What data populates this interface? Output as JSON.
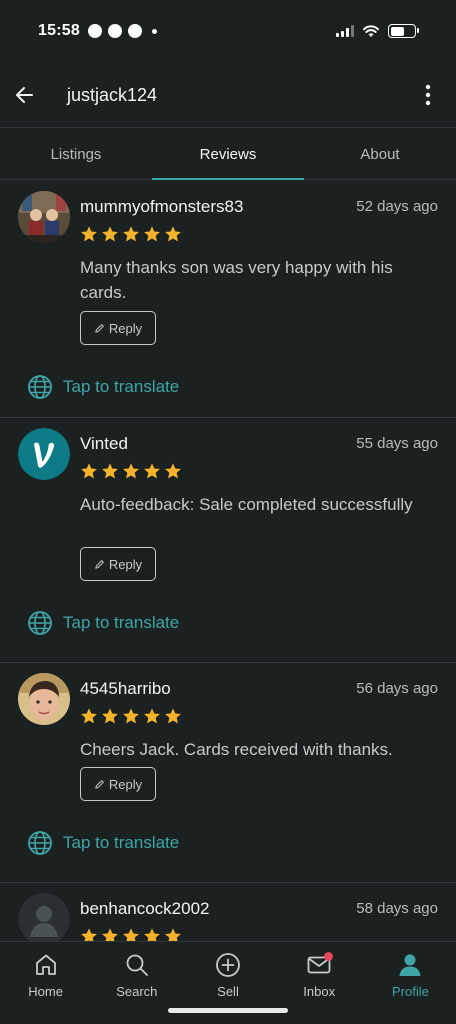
{
  "status_bar": {
    "time": "15:58",
    "battery_level": 0.6
  },
  "header": {
    "title": "justjack124"
  },
  "tabs": [
    {
      "label": "Listings",
      "active": false
    },
    {
      "label": "Reviews",
      "active": true
    },
    {
      "label": "About",
      "active": false
    }
  ],
  "reviews": [
    {
      "username": "mummyofmonsters83",
      "date": "52 days ago",
      "rating": 5,
      "comment": "Many thanks son was very happy with his cards.",
      "reply_label": "Reply",
      "translate_label": "Tap to translate"
    },
    {
      "username": "Vinted",
      "date": "55 days ago",
      "rating": 5,
      "comment": "Auto-feedback: Sale completed successfully",
      "reply_label": "Reply",
      "translate_label": "Tap to translate"
    },
    {
      "username": "4545harribo",
      "date": "56 days ago",
      "rating": 5,
      "comment": "Cheers Jack. Cards received with thanks.",
      "reply_label": "Reply",
      "translate_label": "Tap to translate"
    },
    {
      "username": "benhancock2002",
      "date": "58 days ago",
      "rating": 5
    }
  ],
  "bottom_nav": [
    {
      "label": "Home",
      "icon": "home-icon",
      "active": false
    },
    {
      "label": "Search",
      "icon": "search-icon",
      "active": false
    },
    {
      "label": "Sell",
      "icon": "plus-circle-icon",
      "active": false
    },
    {
      "label": "Inbox",
      "icon": "mail-icon",
      "active": false,
      "notification": true
    },
    {
      "label": "Profile",
      "icon": "profile-icon",
      "active": true
    }
  ],
  "colors": {
    "background": "#1b2021",
    "accent": "#3fa5a6",
    "star": "#f5b32b",
    "notification": "#e8485a",
    "vinted_brand": "#0c7b86"
  }
}
